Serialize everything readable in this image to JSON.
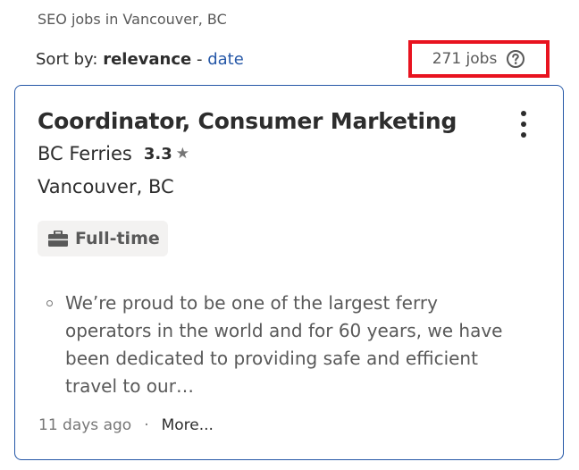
{
  "search": {
    "context": "SEO jobs in Vancouver, BC"
  },
  "sort": {
    "prefix": "Sort by:",
    "active": "relevance",
    "separator": " - ",
    "alternative": "date"
  },
  "results": {
    "count_label": "271 jobs",
    "highlight_color": "#e8131f"
  },
  "job": {
    "title": "Coordinator, Consumer Marketing",
    "company": "BC Ferries",
    "rating": "3.3",
    "location": "Vancouver, BC",
    "job_type": "Full-time",
    "snippet": "We’re proud to be one of the largest ferry operators in the world and for 60 years, we have been dedicated to providing safe and efficient travel to our…",
    "posted": "11 days ago",
    "separator": "·",
    "more_label": "More..."
  },
  "colors": {
    "link": "#2557a7",
    "card_border": "#2557a7",
    "text": "#2d2d2d",
    "muted": "#595959"
  },
  "icons": {
    "help": "question-circle-icon",
    "star": "star-icon",
    "job_type": "briefcase-icon",
    "menu": "kebab-menu-icon"
  }
}
